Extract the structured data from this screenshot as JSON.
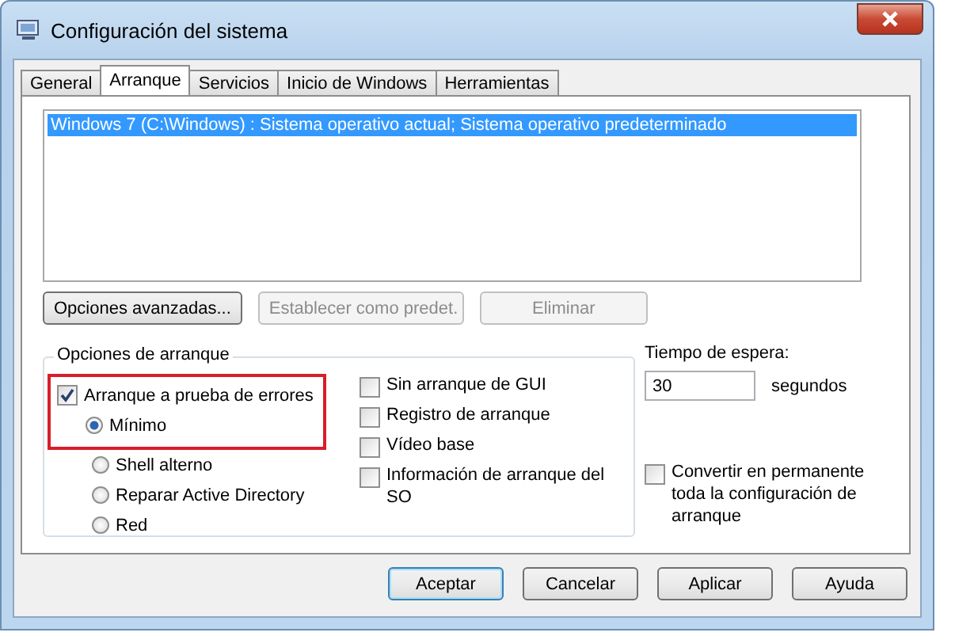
{
  "window": {
    "title": "Configuración del sistema"
  },
  "tabs": [
    {
      "label": "General",
      "selected": false
    },
    {
      "label": "Arranque",
      "selected": true
    },
    {
      "label": "Servicios",
      "selected": false
    },
    {
      "label": "Inicio de Windows",
      "selected": false
    },
    {
      "label": "Herramientas",
      "selected": false
    }
  ],
  "boot_list": [
    {
      "text": "Windows 7 (C:\\Windows) : Sistema operativo actual; Sistema operativo predeterminado",
      "selected": true
    }
  ],
  "list_buttons": [
    {
      "label": "Opciones avanzadas...",
      "disabled": false
    },
    {
      "label": "Establecer como predet.",
      "disabled": true
    },
    {
      "label": "Eliminar",
      "disabled": true
    }
  ],
  "boot_options": {
    "title": "Opciones de arranque",
    "safe_boot": {
      "label": "Arranque a prueba de errores",
      "checked": true,
      "highlighted": true
    },
    "safe_boot_modes": [
      {
        "label": "Mínimo",
        "selected": true
      },
      {
        "label": "Shell alterno",
        "selected": false
      },
      {
        "label": "Reparar Active Directory",
        "selected": false
      },
      {
        "label": "Red",
        "selected": false
      }
    ],
    "flags": [
      {
        "label": "Sin arranque de GUI",
        "checked": false
      },
      {
        "label": "Registro de arranque",
        "checked": false
      },
      {
        "label": "Vídeo base",
        "checked": false
      },
      {
        "label": "Información de arranque del SO",
        "checked": false
      }
    ]
  },
  "timeout": {
    "label": "Tiempo de espera:",
    "value": "30",
    "unit": "segundos"
  },
  "make_permanent": {
    "label": "Convertir en permanente toda la configuración de arranque",
    "checked": false
  },
  "dialog_buttons": [
    {
      "label": "Aceptar",
      "default": true
    },
    {
      "label": "Cancelar",
      "default": false
    },
    {
      "label": "Aplicar",
      "default": false
    },
    {
      "label": "Ayuda",
      "default": false
    }
  ]
}
